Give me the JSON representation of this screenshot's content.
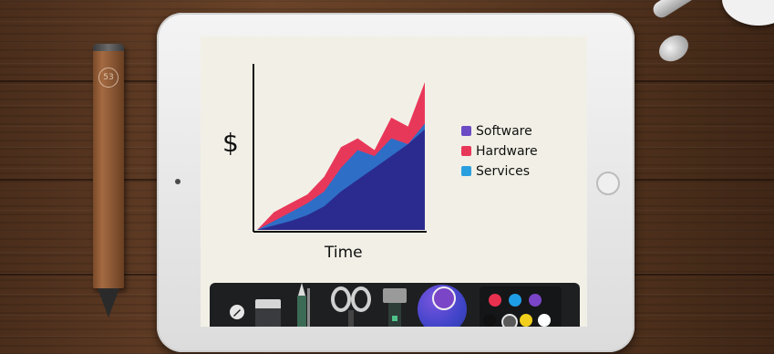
{
  "pencil": {
    "logo_text": "53"
  },
  "chart_data": {
    "type": "area",
    "title": "",
    "xlabel": "Time",
    "ylabel": "$",
    "x": [
      0,
      1,
      2,
      3,
      4,
      5,
      6,
      7,
      8,
      9,
      10
    ],
    "series": [
      {
        "name": "Software",
        "color": "#2b2b8f",
        "values": [
          0,
          3,
          6,
          10,
          16,
          26,
          34,
          42,
          50,
          58,
          68
        ]
      },
      {
        "name": "Services",
        "color": "#2f6ec6",
        "values": [
          0,
          6,
          12,
          18,
          26,
          42,
          54,
          50,
          62,
          58,
          72
        ]
      },
      {
        "name": "Hardware",
        "color": "#e8385a",
        "values": [
          0,
          12,
          18,
          24,
          36,
          56,
          62,
          54,
          76,
          70,
          100
        ]
      }
    ],
    "legend_position": "right"
  },
  "colors": {
    "software": "#6b4cc4",
    "hardware": "#e8385a",
    "services": "#2a9fe0"
  },
  "toolbar": {
    "tools": [
      {
        "name": "pencil-tool-icon"
      },
      {
        "name": "eraser-tool-icon"
      },
      {
        "name": "pen-tool-icon"
      },
      {
        "name": "scissors-tool-icon"
      },
      {
        "name": "marker-tool-icon"
      },
      {
        "name": "color-mixer-icon"
      }
    ],
    "palette": [
      "#e8304f",
      "#1e9ee6",
      "#7a45c7",
      "#111111",
      "#5a5a5a",
      "#f2cf1c",
      "#ffffff"
    ]
  }
}
